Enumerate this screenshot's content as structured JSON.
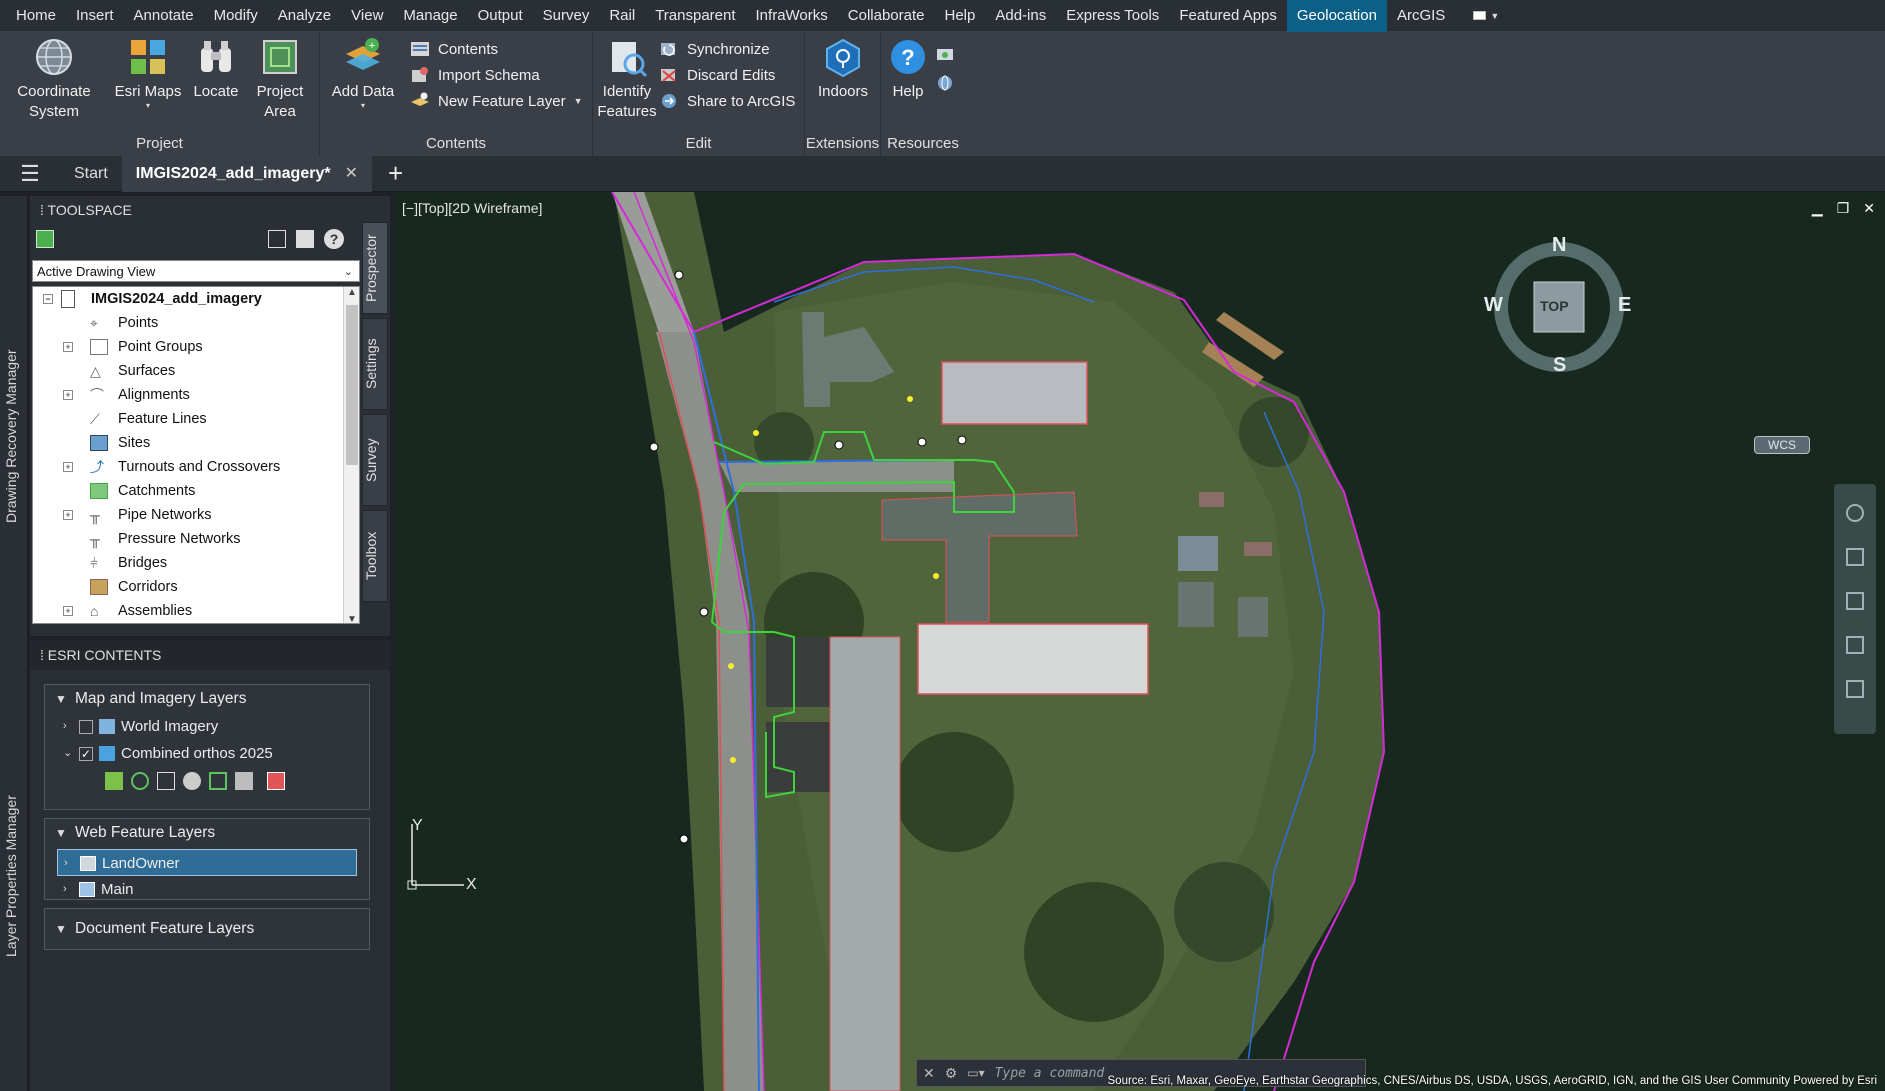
{
  "menu": {
    "tabs": [
      "Home",
      "Insert",
      "Annotate",
      "Modify",
      "Analyze",
      "View",
      "Manage",
      "Output",
      "Survey",
      "Rail",
      "Transparent",
      "InfraWorks",
      "Collaborate",
      "Help",
      "Add-ins",
      "Express Tools",
      "Featured Apps",
      "Geolocation",
      "ArcGIS"
    ],
    "active_tab": "Geolocation"
  },
  "ribbon": {
    "project": {
      "title": "Project",
      "coordinate_system": "Coordinate\nSystem",
      "esri_maps": "Esri Maps",
      "locate": "Locate",
      "project_area": "Project\nArea"
    },
    "contents": {
      "title": "Contents",
      "add_data": "Add Data",
      "contents": "Contents",
      "import_schema": "Import Schema",
      "new_feature_layer": "New Feature Layer"
    },
    "edit": {
      "title": "Edit",
      "identify_features": "Identify\nFeatures",
      "synchronize": "Synchronize",
      "discard_edits": "Discard Edits",
      "share_to_arcgis": "Share to ArcGIS"
    },
    "extensions": {
      "title": "Extensions",
      "indoors": "Indoors"
    },
    "resources": {
      "title": "Resources",
      "help": "Help"
    }
  },
  "doctabs": {
    "start": "Start",
    "active": "IMGIS2024_add_imagery*",
    "close": "✕",
    "plus": "+"
  },
  "vstrip": {
    "drawing_recovery": "Drawing Recovery Manager",
    "layer_properties": "Layer Properties Manager"
  },
  "toolspace": {
    "title": "TOOLSPACE",
    "view_select": "Active Drawing View",
    "root": "IMGIS2024_add_imagery",
    "items": [
      "Points",
      "Point Groups",
      "Surfaces",
      "Alignments",
      "Feature Lines",
      "Sites",
      "Turnouts and Crossovers",
      "Catchments",
      "Pipe Networks",
      "Pressure Networks",
      "Bridges",
      "Corridors",
      "Assemblies"
    ],
    "tabs": [
      "Prospector",
      "Settings",
      "Survey",
      "Toolbox"
    ]
  },
  "esri": {
    "title": "ESRI CONTENTS",
    "map_group": "Map and Imagery Layers",
    "world_imagery": "World Imagery",
    "combined_orthos": "Combined orthos 2025",
    "web_group": "Web Feature Layers",
    "landowner": "LandOwner",
    "main": "Main",
    "doc_group": "Document Feature Layers"
  },
  "viewport": {
    "label": "[−][Top][2D Wireframe]",
    "compass": {
      "n": "N",
      "s": "S",
      "e": "E",
      "w": "W",
      "top": "TOP"
    },
    "wcs": "WCS",
    "ucs_x": "X",
    "ucs_y": "Y",
    "command_placeholder": "Type a command",
    "credits": "Source: Esri, Maxar, GeoEye, Earthstar Geographics, CNES/Airbus DS, USDA, USGS, AeroGRID, IGN, and the GIS User Community  Powered by Esri"
  },
  "colors": {
    "accent": "#0c5f86",
    "boundary_magenta": "#d42ad8",
    "parcel_blue": "#2f6fdc",
    "building_red": "#e0505a",
    "feature_green": "#3ed33e"
  }
}
